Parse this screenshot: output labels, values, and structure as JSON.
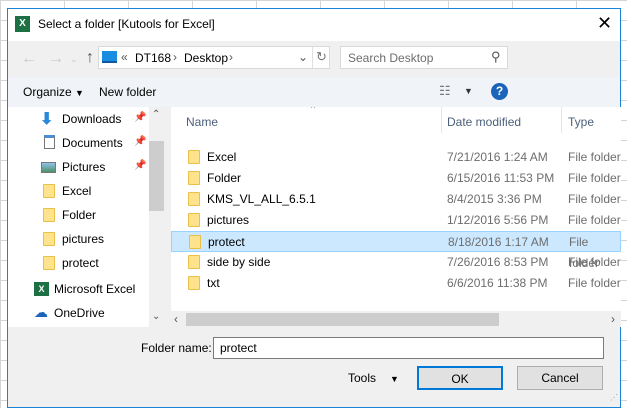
{
  "window": {
    "title": "Select a folder [Kutools for Excel]",
    "close_icon": "close-icon",
    "app_icon": "excel-icon"
  },
  "nav": {
    "breadcrumb": [
      "DT168",
      "Desktop"
    ],
    "overflow": "«",
    "search_placeholder": "Search Desktop"
  },
  "toolbar": {
    "organize": "Organize",
    "new_folder": "New folder",
    "help": "?"
  },
  "sidebar": {
    "items": [
      {
        "label": "Downloads",
        "icon": "download-icon",
        "pinned": true
      },
      {
        "label": "Documents",
        "icon": "document-icon",
        "pinned": true
      },
      {
        "label": "Pictures",
        "icon": "pictures-icon",
        "pinned": true
      },
      {
        "label": "Excel",
        "icon": "folder-icon"
      },
      {
        "label": "Folder",
        "icon": "folder-icon"
      },
      {
        "label": "pictures",
        "icon": "folder-icon"
      },
      {
        "label": "protect",
        "icon": "folder-icon"
      },
      {
        "label": "Microsoft Excel",
        "icon": "excel-icon"
      },
      {
        "label": "OneDrive",
        "icon": "onedrive-icon"
      }
    ]
  },
  "list": {
    "columns": [
      "Name",
      "Date modified",
      "Type"
    ],
    "rows": [
      {
        "name": "Excel",
        "date": "7/21/2016 1:24 AM",
        "type": "File folder"
      },
      {
        "name": "Folder",
        "date": "6/15/2016 11:53 PM",
        "type": "File folder"
      },
      {
        "name": "KMS_VL_ALL_6.5.1",
        "date": "8/4/2015 3:36 PM",
        "type": "File folder"
      },
      {
        "name": "pictures",
        "date": "1/12/2016 5:56 PM",
        "type": "File folder"
      },
      {
        "name": "protect",
        "date": "8/18/2016 1:17 AM",
        "type": "File folder",
        "selected": true
      },
      {
        "name": "side by side",
        "date": "7/26/2016 8:53 PM",
        "type": "File folder"
      },
      {
        "name": "txt",
        "date": "6/6/2016 11:38 PM",
        "type": "File folder"
      }
    ]
  },
  "footer": {
    "folder_label": "Folder name:",
    "folder_value": "protect",
    "tools": "Tools",
    "ok": "OK",
    "cancel": "Cancel"
  },
  "colors": {
    "accent": "#0078d7",
    "selection": "#cce8ff",
    "folder": "#ffe38c"
  }
}
